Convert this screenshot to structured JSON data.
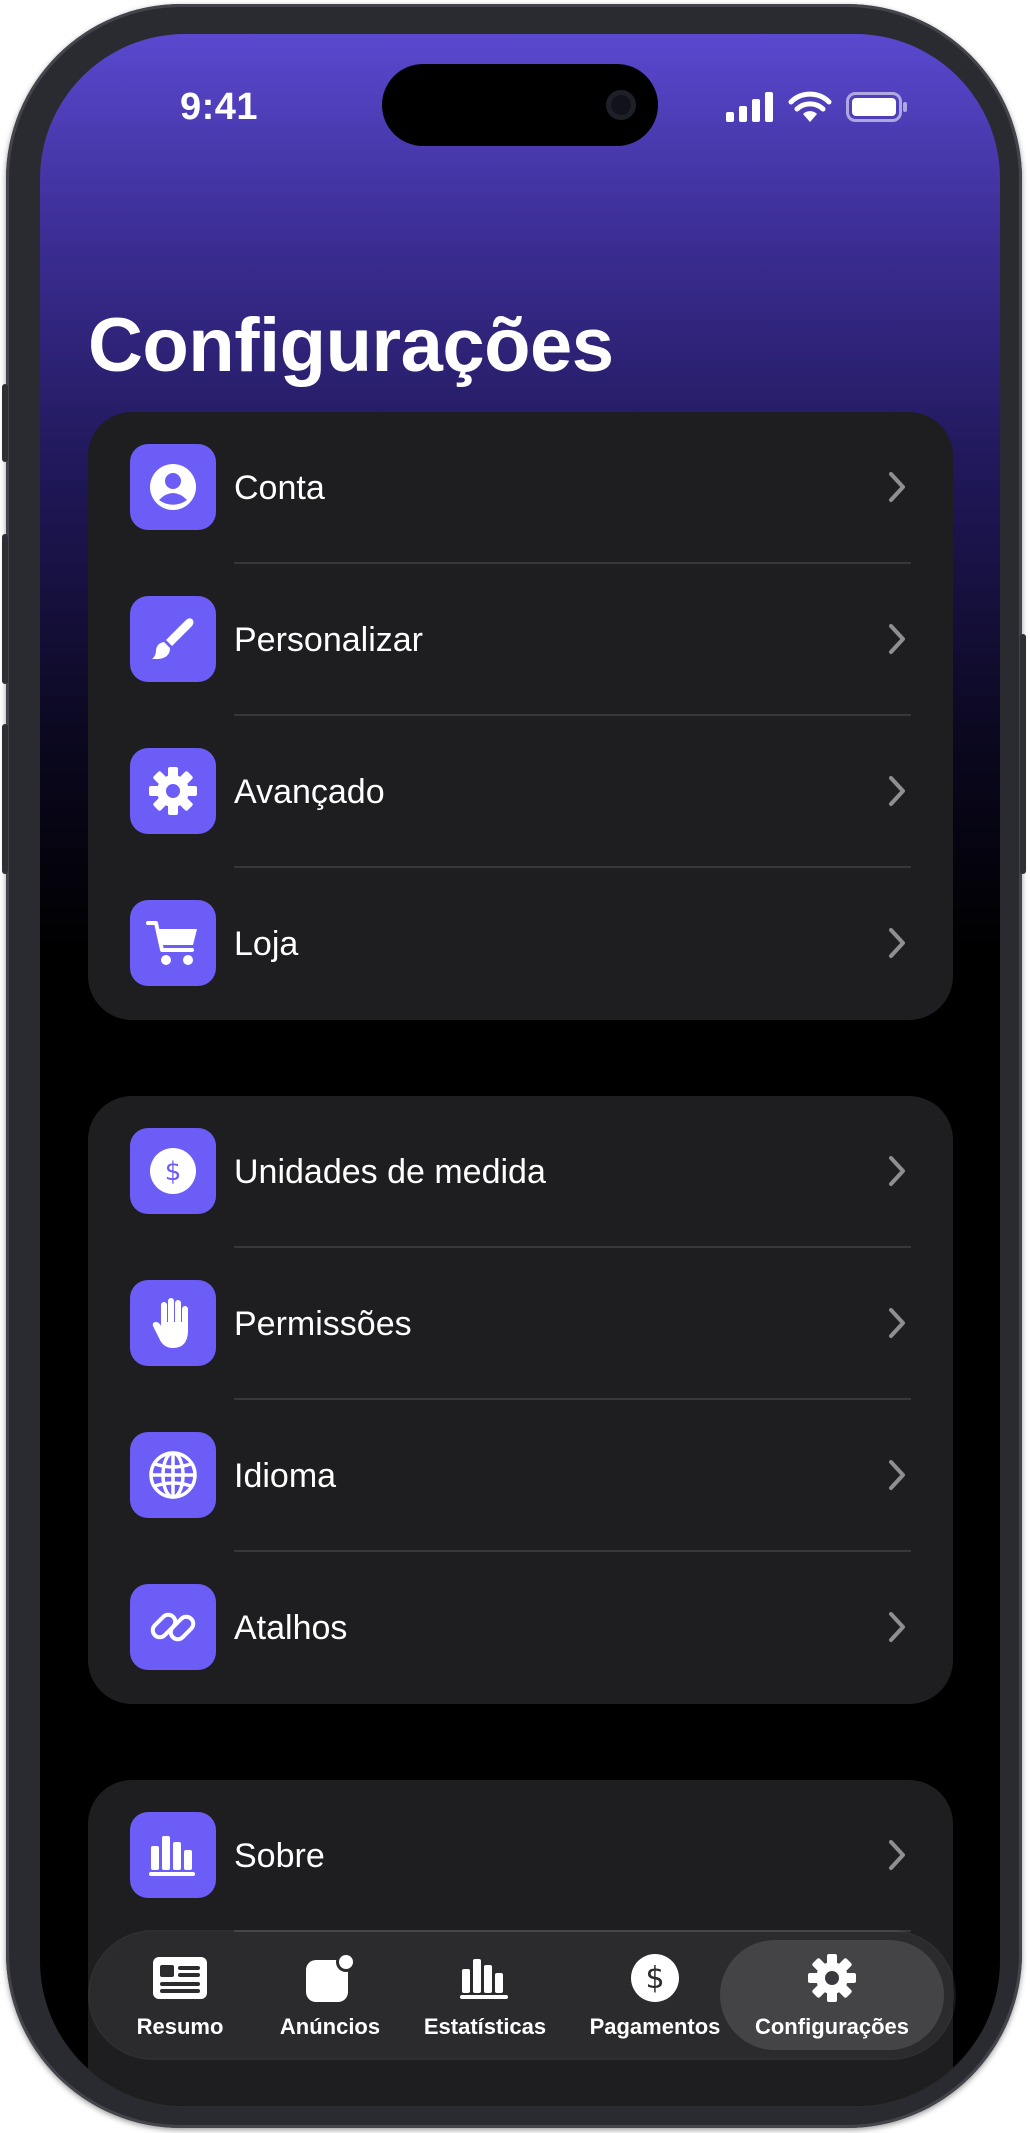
{
  "status_bar": {
    "time": "9:41"
  },
  "page": {
    "title": "Configurações"
  },
  "groups": [
    {
      "items": [
        {
          "label": "Conta",
          "icon": "person-circle-icon"
        },
        {
          "label": "Personalizar",
          "icon": "paintbrush-icon"
        },
        {
          "label": "Avançado",
          "icon": "gear-icon"
        },
        {
          "label": "Loja",
          "icon": "cart-icon"
        }
      ]
    },
    {
      "items": [
        {
          "label": "Unidades de medida",
          "icon": "dollar-circle-icon"
        },
        {
          "label": "Permissões",
          "icon": "hand-icon"
        },
        {
          "label": "Idioma",
          "icon": "globe-icon"
        },
        {
          "label": "Atalhos",
          "icon": "link-icon"
        }
      ]
    },
    {
      "items": [
        {
          "label": "Sobre",
          "icon": "bar-chart-icon"
        }
      ]
    }
  ],
  "tab_bar": {
    "tabs": [
      {
        "label": "Resumo",
        "icon": "newspaper-icon"
      },
      {
        "label": "Anúncios",
        "icon": "badge-app-icon"
      },
      {
        "label": "Estatísticas",
        "icon": "bar-chart-icon"
      },
      {
        "label": "Pagamentos",
        "icon": "dollar-circle-icon"
      },
      {
        "label": "Configurações",
        "icon": "gear-icon",
        "selected": true
      }
    ]
  },
  "colors": {
    "accent": "#6b5df6",
    "header_top": "#5a49cf",
    "cell_bg": "#1e1e20",
    "background": "#000000"
  }
}
